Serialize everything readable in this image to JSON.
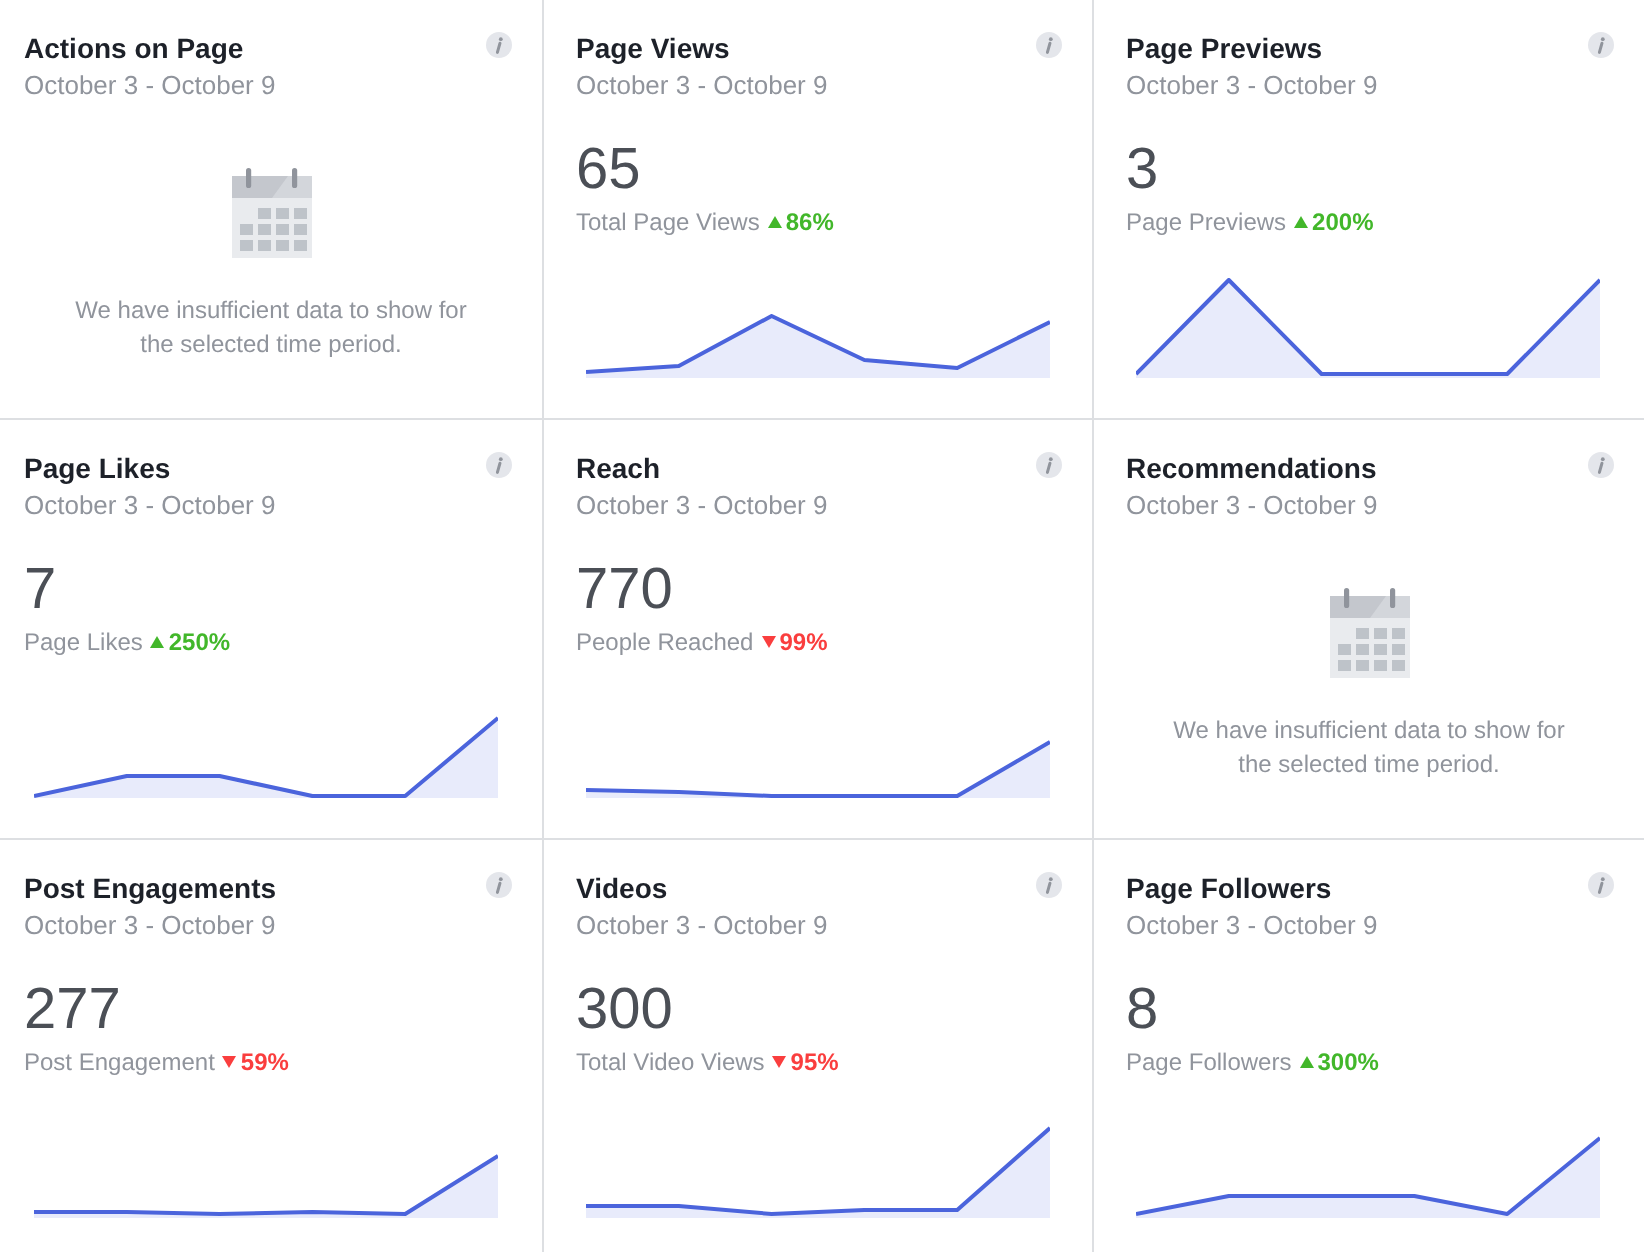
{
  "cards": [
    {
      "kind": "empty",
      "title": "Actions on Page",
      "date_range": "October 3 - October 9",
      "message": "We have insufficient data to show for the selected time period."
    },
    {
      "kind": "chart",
      "title": "Page Views",
      "date_range": "October 3 - October 9",
      "value": "65",
      "metric": "Total Page Views",
      "change": {
        "kind": "up",
        "text": "86%"
      }
    },
    {
      "kind": "chart",
      "title": "Page Previews",
      "date_range": "October 3 - October 9",
      "value": "3",
      "metric": "Page Previews",
      "change": {
        "kind": "up",
        "text": "200%"
      }
    },
    {
      "kind": "chart",
      "title": "Page Likes",
      "date_range": "October 3 - October 9",
      "value": "7",
      "metric": "Page Likes",
      "change": {
        "kind": "up",
        "text": "250%"
      }
    },
    {
      "kind": "chart",
      "title": "Reach",
      "date_range": "October 3 - October 9",
      "value": "770",
      "metric": "People Reached",
      "change": {
        "kind": "down",
        "text": "99%"
      }
    },
    {
      "kind": "empty",
      "title": "Recommendations",
      "date_range": "October 3 - October 9",
      "message": "We have insufficient data to show for the selected time period."
    },
    {
      "kind": "chart",
      "title": "Post Engagements",
      "date_range": "October 3 - October 9",
      "value": "277",
      "metric": "Post Engagement",
      "change": {
        "kind": "down",
        "text": "59%"
      }
    },
    {
      "kind": "chart",
      "title": "Videos",
      "date_range": "October 3 - October 9",
      "value": "300",
      "metric": "Total Video Views",
      "change": {
        "kind": "down",
        "text": "95%"
      }
    },
    {
      "kind": "chart",
      "title": "Page Followers",
      "date_range": "October 3 - October 9",
      "value": "8",
      "metric": "Page Followers",
      "change": {
        "kind": "up",
        "text": "300%"
      }
    }
  ]
}
